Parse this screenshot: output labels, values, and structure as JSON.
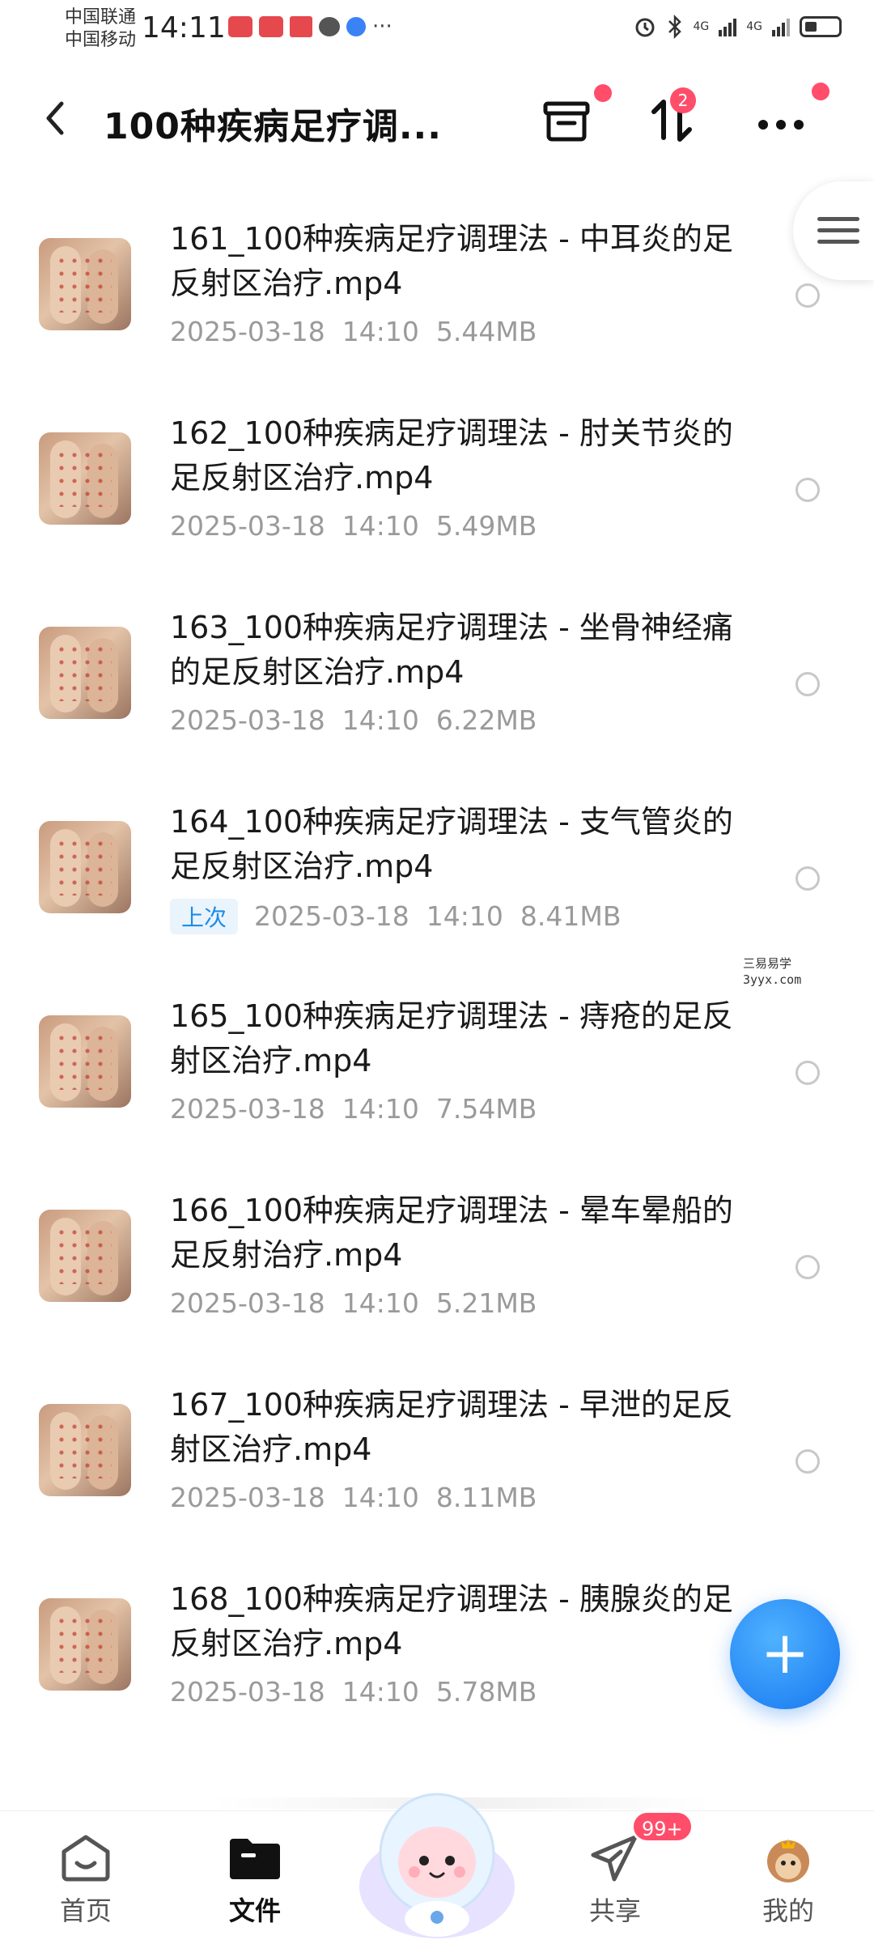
{
  "status_bar": {
    "carrier_1": "中国联通",
    "carrier_2": "中国移动",
    "time": "14:11",
    "network_1": "4G",
    "network_2": "4G"
  },
  "header": {
    "title": "100种疾病足疗调...",
    "sort_badge": "2"
  },
  "files": [
    {
      "name": "161_100种疾病足疗调理法 - 中耳炎的足反射区治疗.mp4",
      "date": "2025-03-18",
      "time": "14:10",
      "size": "5.44MB",
      "tag": ""
    },
    {
      "name": "162_100种疾病足疗调理法 - 肘关节炎的足反射区治疗.mp4",
      "date": "2025-03-18",
      "time": "14:10",
      "size": "5.49MB",
      "tag": ""
    },
    {
      "name": "163_100种疾病足疗调理法 - 坐骨神经痛的足反射区治疗.mp4",
      "date": "2025-03-18",
      "time": "14:10",
      "size": "6.22MB",
      "tag": ""
    },
    {
      "name": "164_100种疾病足疗调理法 - 支气管炎的足反射区治疗.mp4",
      "date": "2025-03-18",
      "time": "14:10",
      "size": "8.41MB",
      "tag": "上次"
    },
    {
      "name": "165_100种疾病足疗调理法 - 痔疮的足反射区治疗.mp4",
      "date": "2025-03-18",
      "time": "14:10",
      "size": "7.54MB",
      "tag": ""
    },
    {
      "name": "166_100种疾病足疗调理法 - 晕车晕船的足反射治疗.mp4",
      "date": "2025-03-18",
      "time": "14:10",
      "size": "5.21MB",
      "tag": ""
    },
    {
      "name": "167_100种疾病足疗调理法 - 早泄的足反射区治疗.mp4",
      "date": "2025-03-18",
      "time": "14:10",
      "size": "8.11MB",
      "tag": ""
    },
    {
      "name": "168_100种疾病足疗调理法 - 胰腺炎的足反射区治疗.mp4",
      "date": "2025-03-18",
      "time": "14:10",
      "size": "5.78MB",
      "tag": ""
    }
  ],
  "watermark": {
    "line1": "三易易学",
    "line2": "3yyx.com"
  },
  "fab": {
    "symbol": "+"
  },
  "bottom_nav": {
    "home": "首页",
    "files": "文件",
    "share": "共享",
    "mine": "我的",
    "share_badge": "99+"
  },
  "colors": {
    "accent": "#1677f0",
    "badge": "#ff4d6a",
    "meta_text": "#9a9a9a"
  }
}
